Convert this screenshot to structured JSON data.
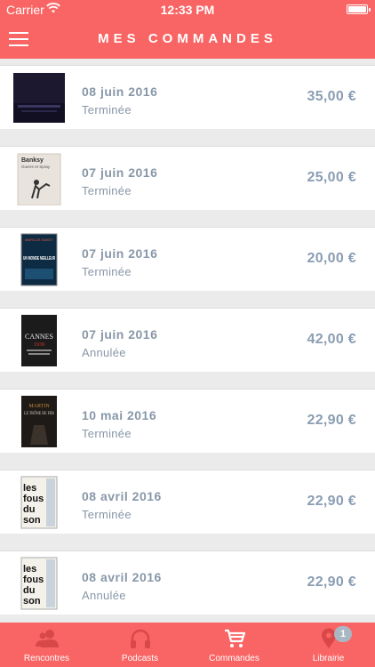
{
  "status_bar": {
    "carrier": "Carrier",
    "time": "12:33 PM"
  },
  "header": {
    "title": "MES COMMANDES",
    "menu_icon": "hamburger-menu-icon"
  },
  "orders": [
    {
      "date": "08 juin 2016",
      "status": "Terminée",
      "price": "35,00 €",
      "cover": "dark-night-cover"
    },
    {
      "date": "07 juin 2016",
      "status": "Terminée",
      "price": "25,00 €",
      "cover": "banksy-cover",
      "cover_text": [
        "Banksy",
        "Guerre et Spray"
      ]
    },
    {
      "date": "07 juin 2016",
      "status": "Terminée",
      "price": "20,00 €",
      "cover": "un-monde-meilleur-cover",
      "cover_text": [
        "MARCUS SAKEY",
        "UN MONDE MEILLEUR"
      ]
    },
    {
      "date": "07 juin 2016",
      "status": "Annulée",
      "price": "42,00 €",
      "cover": "cannes-1939-cover",
      "cover_text": [
        "CANNES",
        "1939"
      ]
    },
    {
      "date": "10 mai 2016",
      "status": "Terminée",
      "price": "22,90 €",
      "cover": "le-trone-de-fer-cover",
      "cover_text": [
        "MARTIN",
        "LE TRÔNE DE FER"
      ]
    },
    {
      "date": "08 avril 2016",
      "status": "Terminée",
      "price": "22,90 €",
      "cover": "les-fous-du-son-cover",
      "cover_text": [
        "les",
        "fous",
        "du",
        "son"
      ]
    },
    {
      "date": "08 avril 2016",
      "status": "Annulée",
      "price": "22,90 €",
      "cover": "les-fous-du-son-cover",
      "cover_text": [
        "les",
        "fous",
        "du",
        "son"
      ]
    }
  ],
  "tabbar": {
    "items": [
      {
        "label": "Rencontres",
        "icon": "people-icon"
      },
      {
        "label": "Podcasts",
        "icon": "headphones-icon"
      },
      {
        "label": "Commandes",
        "icon": "cart-icon",
        "active": true
      },
      {
        "label": "Librairie",
        "icon": "map-pin-icon"
      }
    ],
    "badge": "1"
  },
  "colors": {
    "accent": "#f96464",
    "text": "#8897a8",
    "background": "#ebebeb"
  }
}
